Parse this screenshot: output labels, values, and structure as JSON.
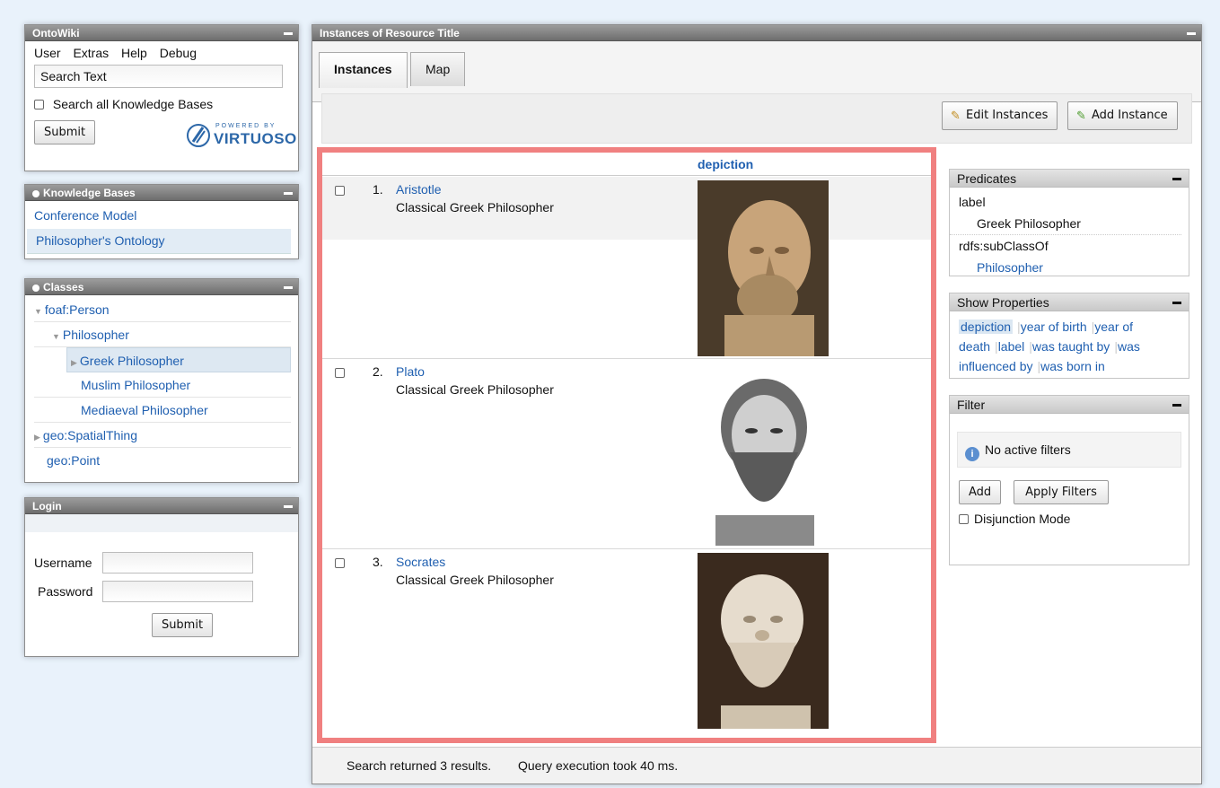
{
  "ontowiki": {
    "title": "OntoWiki",
    "menu": [
      "User",
      "Extras",
      "Help",
      "Debug"
    ],
    "search_value": "Search Text",
    "search_all_label": "Search all Knowledge Bases",
    "submit_label": "Submit",
    "powered_by": "POWERED BY",
    "virtuoso": "VIRTUOSO"
  },
  "knowledge_bases": {
    "title": "Knowledge Bases",
    "items": [
      "Conference Model",
      "Philosopher's Ontology"
    ]
  },
  "classes": {
    "title": "Classes",
    "items": [
      {
        "label": "foaf:Person"
      },
      {
        "label": "Philosopher"
      },
      {
        "label": "Greek Philosopher"
      },
      {
        "label": "Muslim Philosopher"
      },
      {
        "label": "Mediaeval Philosopher"
      },
      {
        "label": "geo:SpatialThing"
      },
      {
        "label": "geo:Point"
      }
    ]
  },
  "login": {
    "title": "Login",
    "username_label": "Username",
    "password_label": "Password",
    "submit_label": "Submit"
  },
  "main": {
    "title": "Instances of Resource Title",
    "tabs": [
      "Instances",
      "Map"
    ],
    "edit_instances_label": "Edit Instances",
    "add_instance_label": "Add Instance",
    "column_header": "depiction",
    "rows": [
      {
        "num": "1.",
        "name": "Aristotle",
        "desc": "Classical Greek Philosopher"
      },
      {
        "num": "2.",
        "name": "Plato",
        "desc": "Classical Greek Philosopher"
      },
      {
        "num": "3.",
        "name": "Socrates",
        "desc": "Classical Greek Philosopher"
      }
    ],
    "status": "Search returned 3 results.",
    "query_time": "Query execution took 40 ms."
  },
  "predicates": {
    "title": "Predicates",
    "label_key": "label",
    "label_value": "Greek Philosopher",
    "subclass_key": "rdfs:subClassOf",
    "subclass_value": "Philosopher"
  },
  "show_properties": {
    "title": "Show Properties",
    "items": [
      "depiction",
      "year of birth",
      "year of death",
      "label",
      "was taught by",
      "was influenced by",
      "was born in"
    ]
  },
  "filter": {
    "title": "Filter",
    "no_filters": "No active filters",
    "add_label": "Add",
    "apply_label": "Apply Filters",
    "disjunction_label": "Disjunction Mode"
  }
}
